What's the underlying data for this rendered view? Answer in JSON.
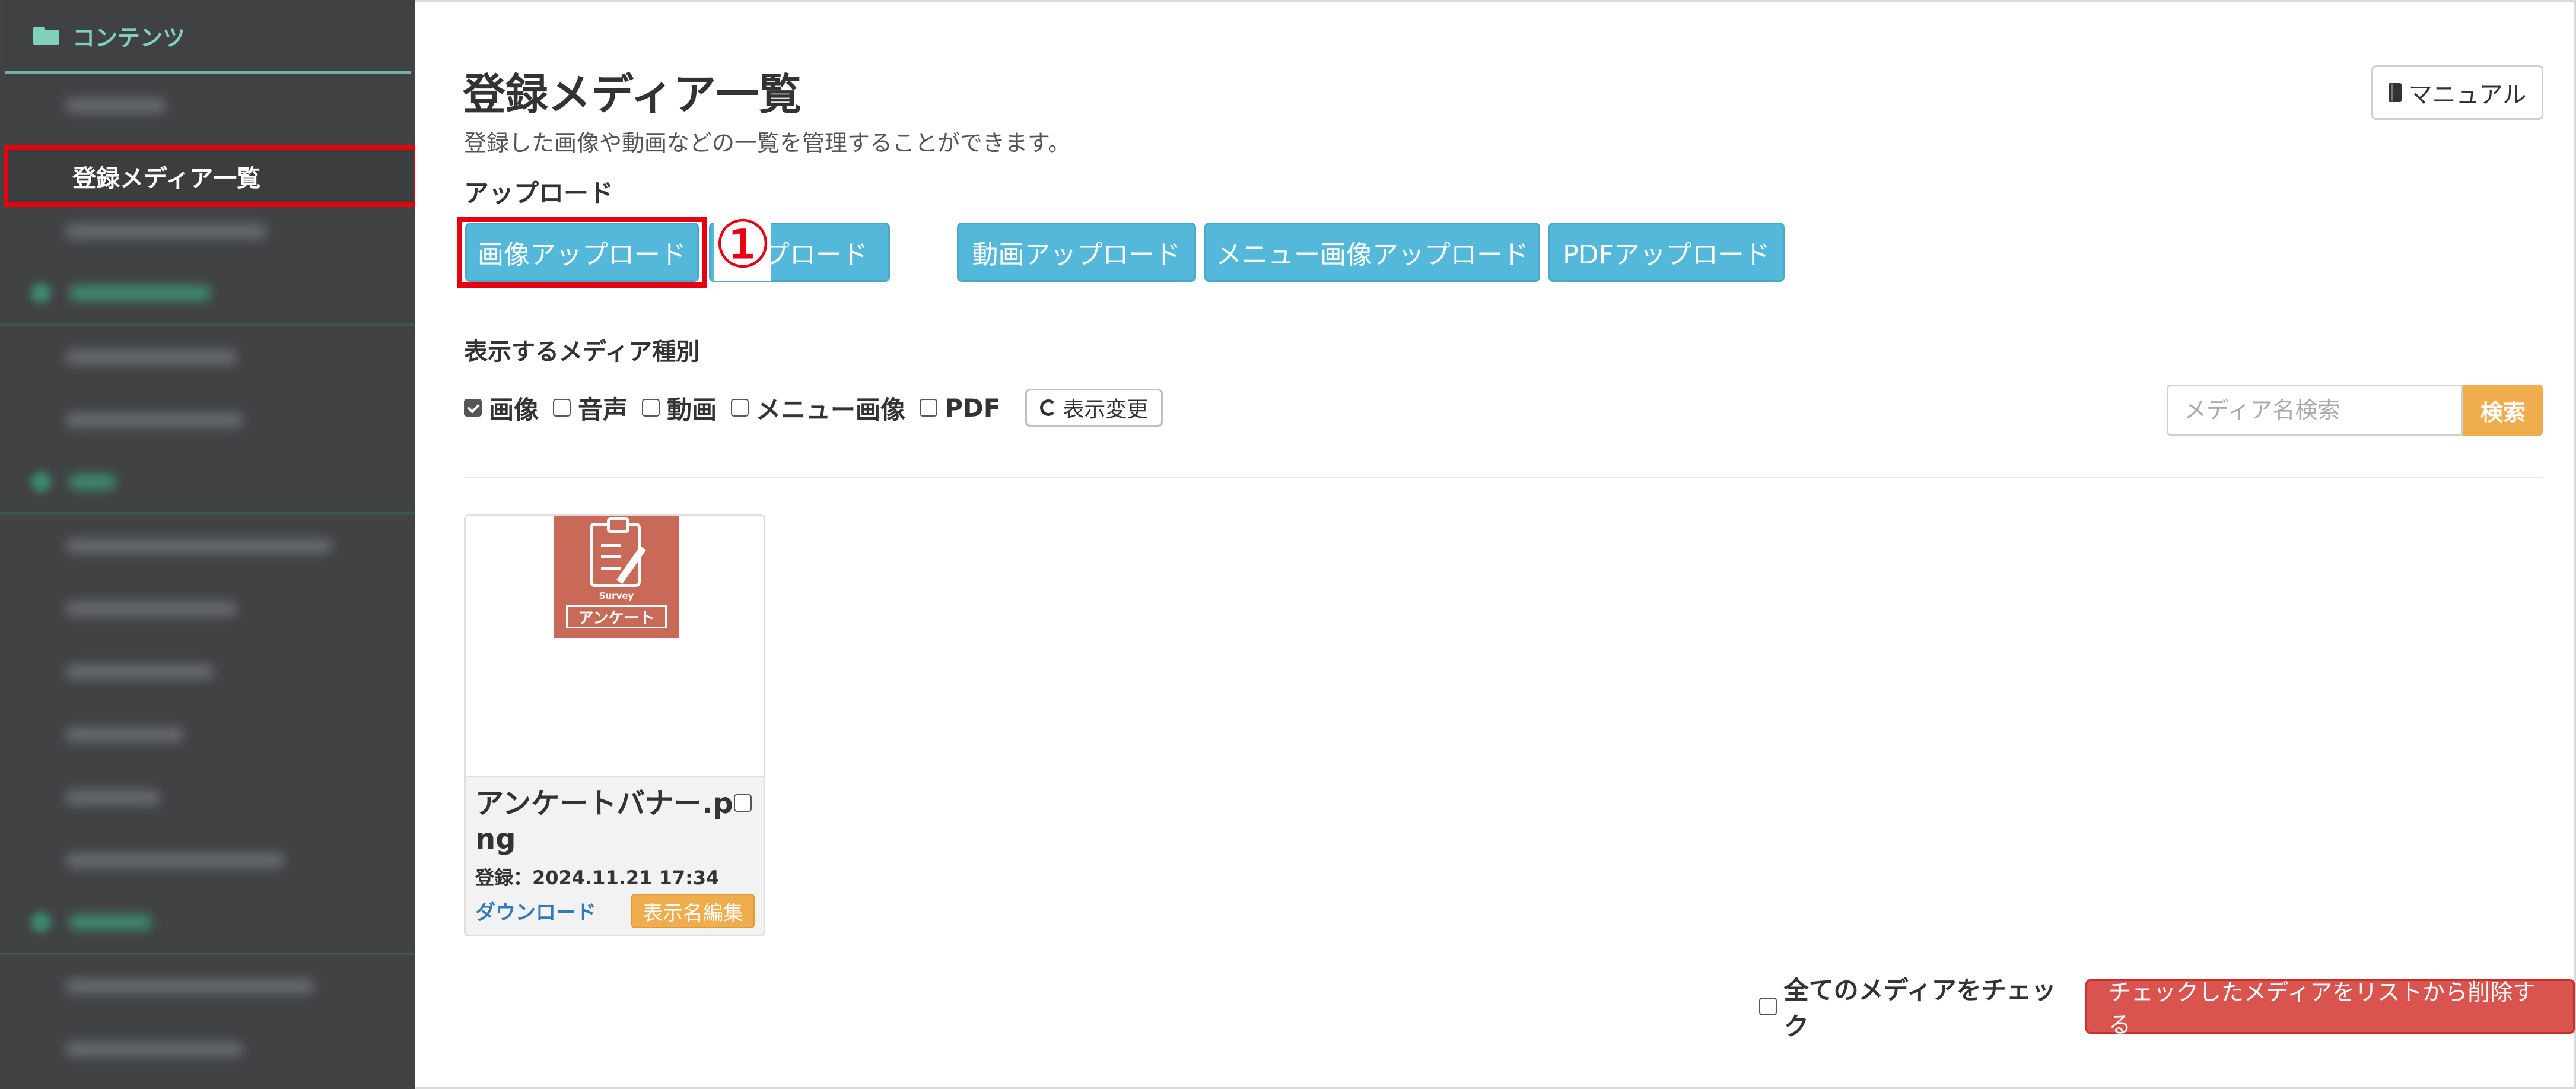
{
  "sidebar": {
    "header_label": "コンテンツ",
    "active_item": "登録メディア一覧"
  },
  "page": {
    "title": "登録メディア一覧",
    "subtitle": "登録した画像や動画などの一覧を管理することができます。",
    "manual_label": "マニュアル"
  },
  "upload": {
    "section_label": "アップロード",
    "buttons": [
      "画像アップロード",
      "ップロード",
      "動画アップロード",
      "メニュー画像アップロード",
      "PDFアップロード"
    ],
    "annotation_number": "①"
  },
  "filters": {
    "section_label": "表示するメディア種別",
    "options": [
      {
        "label": "画像",
        "checked": true
      },
      {
        "label": "音声",
        "checked": false
      },
      {
        "label": "動画",
        "checked": false
      },
      {
        "label": "メニュー画像",
        "checked": false
      },
      {
        "label": "PDF",
        "checked": false
      }
    ],
    "refresh_label": "表示変更",
    "search_placeholder": "メディア名検索",
    "search_button": "検索"
  },
  "media_items": [
    {
      "thumbnail_caption": "Survey",
      "thumbnail_banner": "アンケート",
      "filename": "アンケートバナー.png",
      "registered": "登録：2024.11.21 17:34",
      "download_label": "ダウンロード",
      "edit_label": "表示名編集",
      "checked": false
    }
  ],
  "footer": {
    "check_all_label": "全てのメディアをチェック",
    "delete_label": "チェックしたメディアをリストから削除する"
  },
  "colors": {
    "sidebar_bg": "#404244",
    "accent_green": "#7fd0bd",
    "upload_blue": "#54b8db",
    "highlight_red": "#e60012",
    "warning_orange": "#f0ad4e",
    "danger_red": "#d9534f"
  }
}
